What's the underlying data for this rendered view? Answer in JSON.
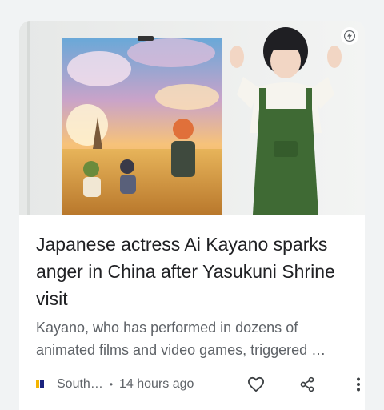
{
  "article": {
    "headline": "Japanese actress Ai Kayano sparks anger in China after Yasukuni Shrine visit",
    "snippet": "Kayano, who has performed in dozens of animated films and video games, triggered …"
  },
  "footer": {
    "source": "South…",
    "separator": "•",
    "time": "14 hours ago"
  },
  "icons": {
    "amp": "lightning-bolt-icon",
    "like": "heart-outline-icon",
    "share": "share-icon",
    "more": "more-vert-icon",
    "publisher_logo": "publisher-logo-icon"
  },
  "colors": {
    "headline": "#202124",
    "secondary": "#5f6368",
    "logo_yellow": "#f4b400",
    "logo_navy": "#1a237e"
  }
}
